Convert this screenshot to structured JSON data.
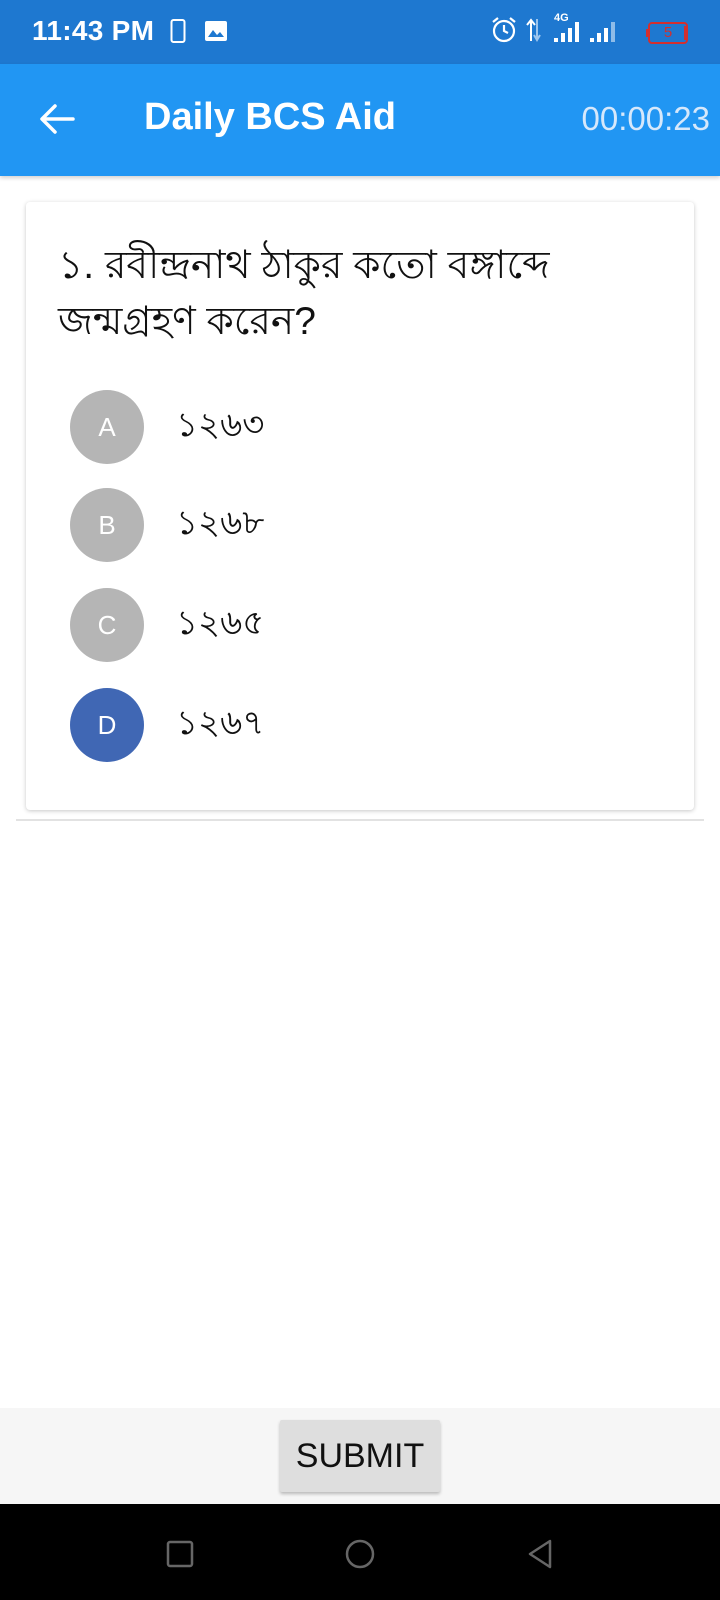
{
  "status_bar": {
    "time": "11:43 PM",
    "network": "4G",
    "battery_level": "5",
    "icons": [
      "phone-outline-icon",
      "image-icon",
      "alarm-icon",
      "data-arrows-icon",
      "signal-icon",
      "battery-icon"
    ]
  },
  "app_bar": {
    "title": "Daily BCS Aid",
    "timer": "00:00:23",
    "back_icon": "arrow-left-icon",
    "color": "#2196f3"
  },
  "question": {
    "text": "১. রবীন্দ্রনাথ ঠাকুর কতো বঙ্গাব্দে জন্মগ্রহণ করেন?",
    "options": [
      {
        "letter": "A",
        "text": "১২৬৩",
        "selected": false
      },
      {
        "letter": "B",
        "text": "১২৬৮",
        "selected": false
      },
      {
        "letter": "C",
        "text": "১২৬৫",
        "selected": false
      },
      {
        "letter": "D",
        "text": "১২৬৭",
        "selected": true
      }
    ],
    "selected_color": "#4067b4",
    "unselected_color": "#b5b5b5"
  },
  "footer": {
    "submit_label": "SUBMIT"
  },
  "nav": {
    "icons": [
      "recents-square-icon",
      "home-circle-icon",
      "back-triangle-icon"
    ]
  }
}
